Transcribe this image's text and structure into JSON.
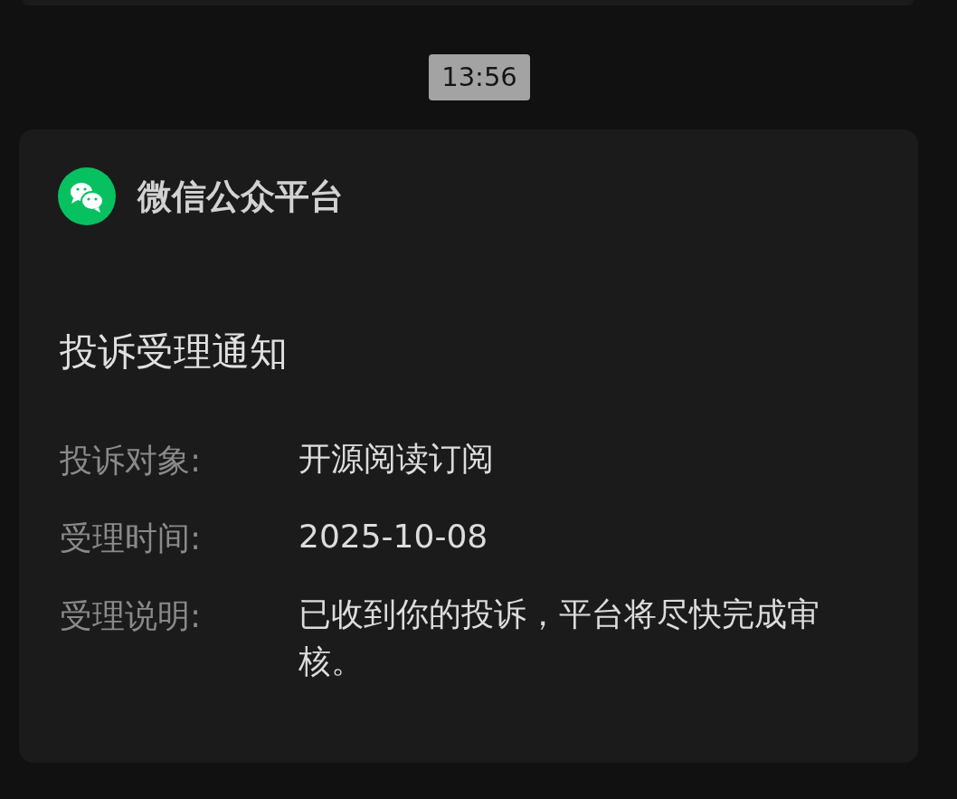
{
  "time_stamp": "13:56",
  "card": {
    "account": "微信公众平台",
    "title": "投诉受理通知",
    "fields": [
      {
        "label": "投诉对象:",
        "value": "开源阅读订阅"
      },
      {
        "label": "受理时间:",
        "value": "2025-10-08"
      },
      {
        "label": "受理说明:",
        "value": "已收到你的投诉，平台将尽快完成审核。"
      }
    ]
  }
}
